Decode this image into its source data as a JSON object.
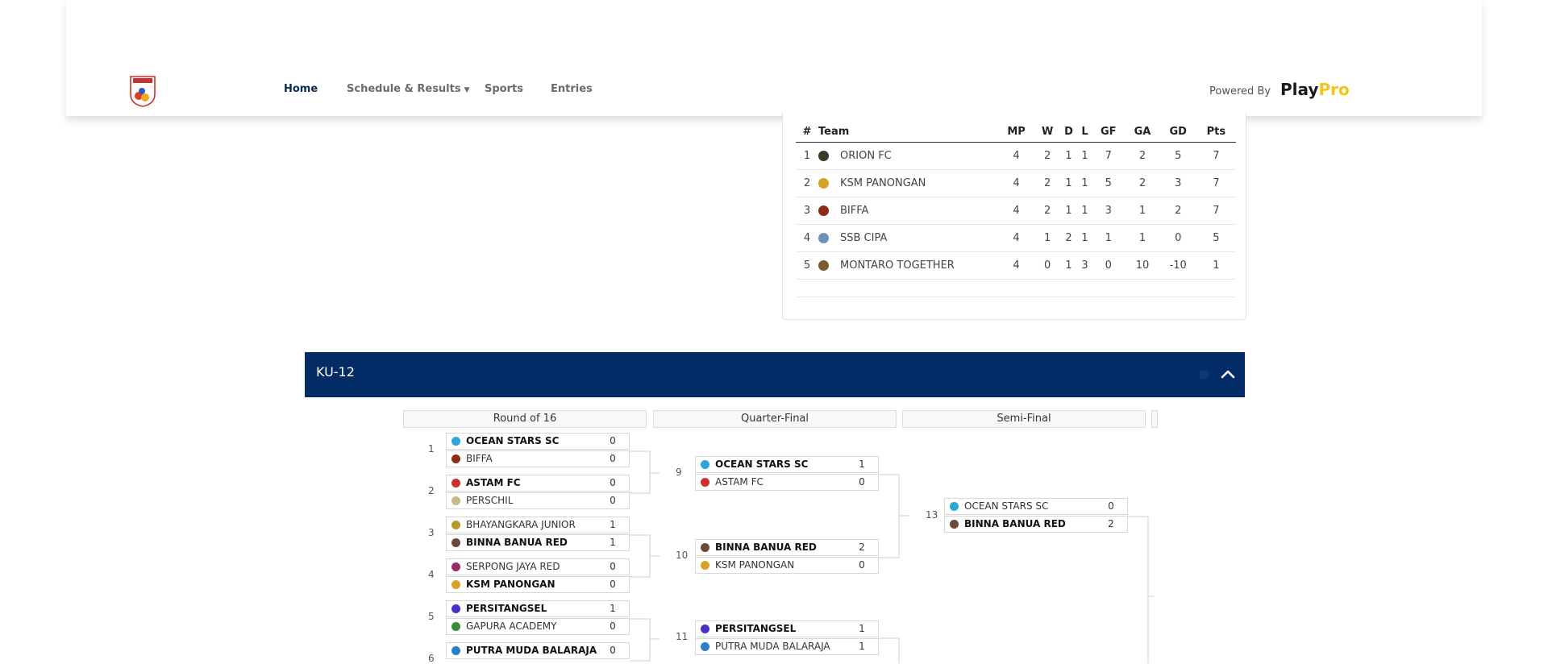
{
  "nav": {
    "links": [
      {
        "label": "Home",
        "active": true
      },
      {
        "label": "Schedule & Results",
        "dropdown": true
      },
      {
        "label": "Sports"
      },
      {
        "label": "Entries"
      }
    ],
    "powered_by": "Powered By",
    "brand_play": "Play",
    "brand_pro": "Pro",
    "brand_colors": {
      "play": "#1a1a1a",
      "pro": "#f3c515"
    }
  },
  "standings": {
    "headers": [
      "#",
      "Team",
      "MP",
      "W",
      "D",
      "L",
      "GF",
      "GA",
      "GD",
      "Pts"
    ],
    "rows": [
      {
        "rank": "1",
        "team": "ORION FC",
        "logo_color": "#3b3b2a",
        "mp": "4",
        "w": "2",
        "d": "1",
        "l": "1",
        "gf": "7",
        "ga": "2",
        "gd": "5",
        "pts": "7"
      },
      {
        "rank": "2",
        "team": "KSM PANONGAN",
        "logo_color": "#d9a227",
        "mp": "4",
        "w": "2",
        "d": "1",
        "l": "1",
        "gf": "5",
        "ga": "2",
        "gd": "3",
        "pts": "7"
      },
      {
        "rank": "3",
        "team": "BIFFA",
        "logo_color": "#8b2d1a",
        "mp": "4",
        "w": "2",
        "d": "1",
        "l": "1",
        "gf": "3",
        "ga": "1",
        "gd": "2",
        "pts": "7"
      },
      {
        "rank": "4",
        "team": "SSB CIPA",
        "logo_color": "#6f93b8",
        "mp": "4",
        "w": "1",
        "d": "2",
        "l": "1",
        "gf": "1",
        "ga": "1",
        "gd": "0",
        "pts": "5"
      },
      {
        "rank": "5",
        "team": "MONTARO TOGETHER",
        "logo_color": "#7a5a2e",
        "mp": "4",
        "w": "0",
        "d": "1",
        "l": "3",
        "gf": "0",
        "ga": "10",
        "gd": "-10",
        "pts": "1"
      }
    ]
  },
  "ku12": {
    "title": "KU-12",
    "header_color": "#032b66",
    "rounds": [
      "Round of 16",
      "Quarter-Final",
      "Semi-Final"
    ],
    "round16": [
      {
        "num": "1",
        "teams": [
          {
            "name": "OCEAN STARS SC",
            "score": "0",
            "win": true,
            "icon": "#2aa7d9"
          },
          {
            "name": "BIFFA",
            "score": "0",
            "win": false,
            "icon": "#8b2d1a"
          }
        ]
      },
      {
        "num": "2",
        "teams": [
          {
            "name": "ASTAM FC",
            "score": "0",
            "win": true,
            "icon": "#c8342b"
          },
          {
            "name": "PERSCHIL",
            "score": "0",
            "win": false,
            "icon": "#c9b98a"
          }
        ]
      },
      {
        "num": "3",
        "teams": [
          {
            "name": "BHAYANGKARA JUNIOR",
            "score": "1",
            "win": false,
            "icon": "#b59a2c"
          },
          {
            "name": "BINNA BANUA RED",
            "score": "1",
            "win": true,
            "icon": "#6b4a3a"
          }
        ]
      },
      {
        "num": "4",
        "teams": [
          {
            "name": "SERPONG JAYA RED",
            "score": "0",
            "win": false,
            "icon": "#9b2c6a"
          },
          {
            "name": "KSM PANONGAN",
            "score": "0",
            "win": true,
            "icon": "#d9a227"
          }
        ]
      },
      {
        "num": "5",
        "teams": [
          {
            "name": "PERSITANGSEL",
            "score": "1",
            "win": true,
            "icon": "#4b2fc9"
          },
          {
            "name": "GAPURA ACADEMY",
            "score": "0",
            "win": false,
            "icon": "#3a8a3a"
          }
        ]
      },
      {
        "num": "6",
        "teams": [
          {
            "name": "PUTRA MUDA BALARAJA",
            "score": "0",
            "win": true,
            "icon": "#2a7fc9"
          }
        ]
      }
    ],
    "quarter": [
      {
        "num": "9",
        "teams": [
          {
            "name": "OCEAN STARS SC",
            "score": "1",
            "win": true,
            "icon": "#2aa7d9"
          },
          {
            "name": "ASTAM FC",
            "score": "0",
            "win": false,
            "icon": "#c8342b"
          }
        ]
      },
      {
        "num": "10",
        "teams": [
          {
            "name": "BINNA BANUA RED",
            "score": "2",
            "win": true,
            "icon": "#6b4a3a"
          },
          {
            "name": "KSM PANONGAN",
            "score": "0",
            "win": false,
            "icon": "#d9a227"
          }
        ]
      },
      {
        "num": "11",
        "teams": [
          {
            "name": "PERSITANGSEL",
            "score": "1",
            "win": true,
            "icon": "#4b2fc9"
          },
          {
            "name": "PUTRA MUDA BALARAJA",
            "score": "1",
            "win": false,
            "icon": "#2a7fc9"
          }
        ]
      }
    ],
    "semi": [
      {
        "num": "13",
        "teams": [
          {
            "name": "OCEAN STARS SC",
            "score": "0",
            "win": false,
            "icon": "#2aa7d9"
          },
          {
            "name": "BINNA BANUA RED",
            "score": "2",
            "win": true,
            "icon": "#6b4a3a"
          }
        ]
      }
    ]
  }
}
